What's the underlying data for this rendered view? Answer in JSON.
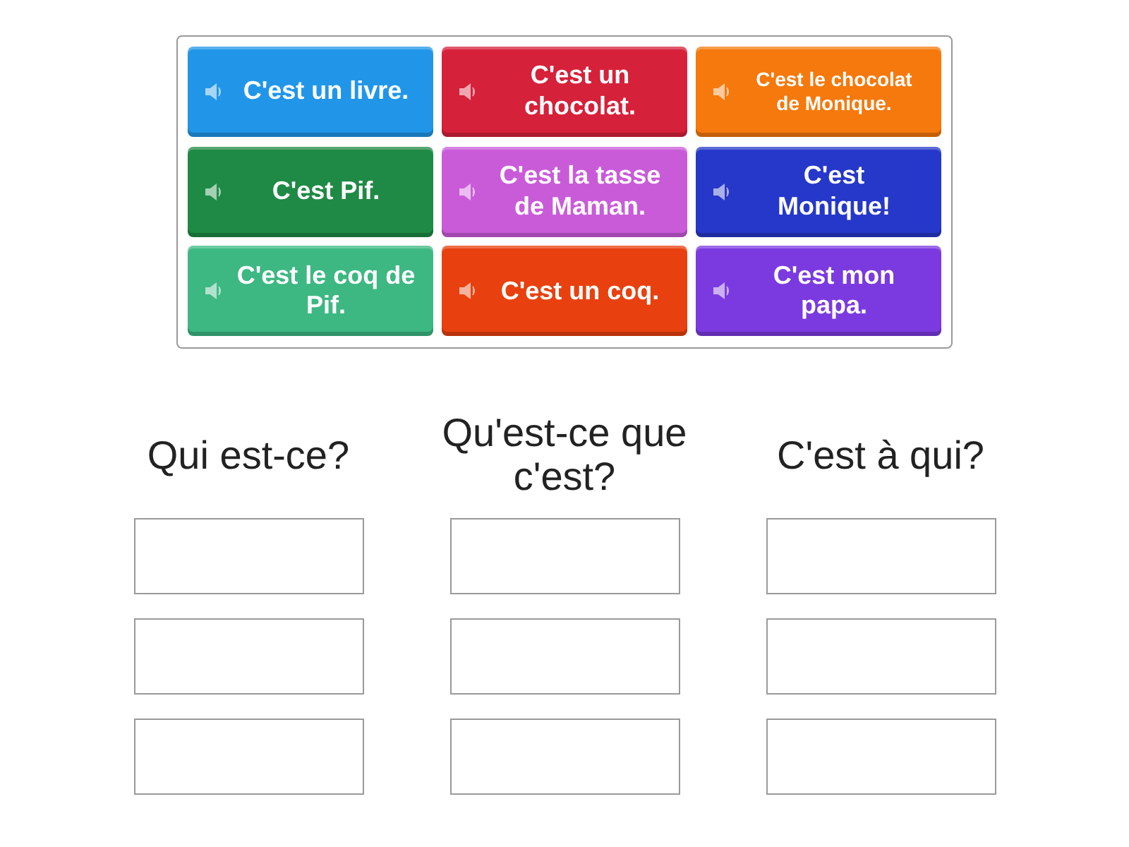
{
  "tiles": [
    {
      "text": "C'est un livre.",
      "color": "#2196e8"
    },
    {
      "text": "C'est un chocolat.",
      "color": "#d6213a"
    },
    {
      "text": "C'est le chocolat de Monique.",
      "color": "#f5790c"
    },
    {
      "text": "C'est Pif.",
      "color": "#1f8a45"
    },
    {
      "text": "C'est la tasse de Maman.",
      "color": "#c95bd9"
    },
    {
      "text": "C'est Monique!",
      "color": "#2638c9"
    },
    {
      "text": "C'est le coq de Pif.",
      "color": "#3db882"
    },
    {
      "text": "C'est un coq.",
      "color": "#e8410f"
    },
    {
      "text": "C'est mon papa.",
      "color": "#7b3ae0"
    }
  ],
  "groups": [
    {
      "title": "Qui est-ce?"
    },
    {
      "title": "Qu'est-ce que c'est?"
    },
    {
      "title": "C'est à qui?"
    }
  ]
}
